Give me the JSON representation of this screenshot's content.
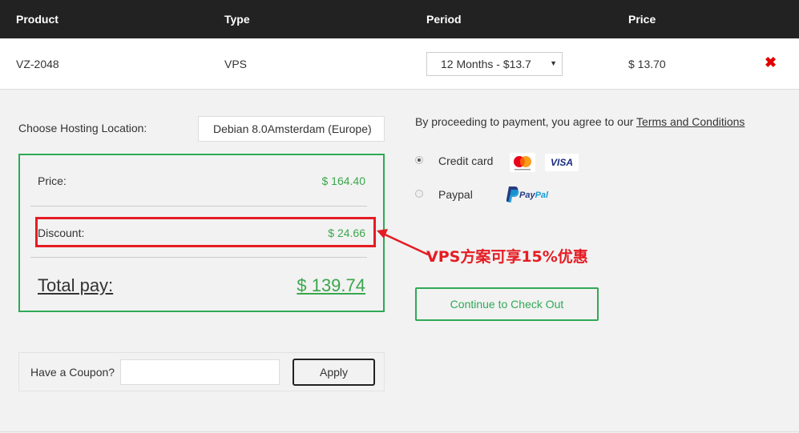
{
  "table": {
    "headers": [
      "Product",
      "Type",
      "Period",
      "Price"
    ],
    "row": {
      "product": "VZ-2048",
      "type": "VPS",
      "period": "12 Months - $13.7",
      "price": "$ 13.70",
      "remove_icon": "close-icon"
    }
  },
  "location": {
    "label": "Choose Hosting Location:",
    "value": "Debian 8.0Amsterdam (Europe)"
  },
  "summary": {
    "price_label": "Price:",
    "price_value": "$ 164.40",
    "discount_label": "Discount:",
    "discount_value": "$ 24.66",
    "total_label": "Total pay:",
    "total_value": "$ 139.74"
  },
  "coupon": {
    "label": "Have a Coupon?",
    "input_value": "",
    "apply_label": "Apply"
  },
  "payment": {
    "terms_text": "By proceeding to payment, you agree to our ",
    "terms_link": "Terms and Conditions",
    "methods": [
      {
        "label": "Credit card",
        "selected": true,
        "icons": [
          "mastercard-icon",
          "visa-icon"
        ]
      },
      {
        "label": "Paypal",
        "selected": false,
        "icons": [
          "paypal-icon"
        ]
      }
    ],
    "visa_text": "VISA",
    "paypal_text_a": "Pay",
    "paypal_text_b": "Pal",
    "checkout_label": "Continue to Check Out"
  },
  "annotation": {
    "text": "VPS方案可享15%优惠"
  },
  "colors": {
    "header_bg": "#222222",
    "accent_green": "#2eaa55",
    "value_green": "#3aa64c",
    "annotation_red": "#e51c23",
    "remove_red": "#e00000"
  }
}
